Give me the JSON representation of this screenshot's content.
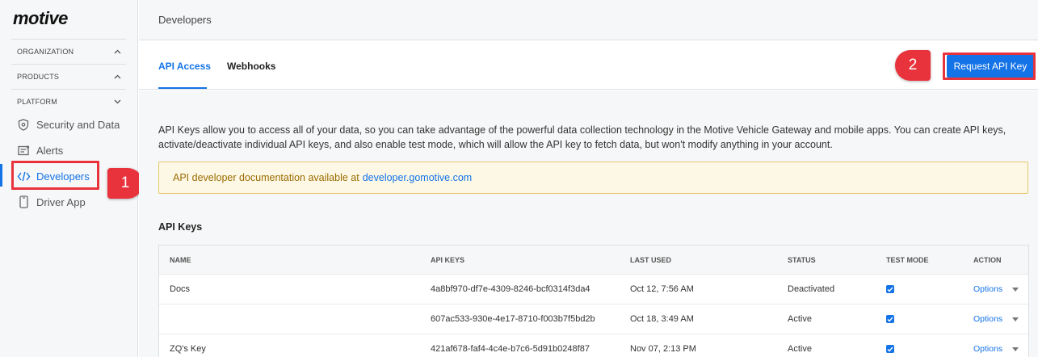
{
  "sidebar": {
    "logo": "motive",
    "sections": [
      {
        "label": "ORGANIZATION",
        "chevron": "up"
      },
      {
        "label": "PRODUCTS",
        "chevron": "up"
      },
      {
        "label": "PLATFORM",
        "chevron": "down"
      }
    ],
    "items": [
      {
        "label": "Security and Data",
        "icon": "shield-icon"
      },
      {
        "label": "Alerts",
        "icon": "alert-list-icon"
      },
      {
        "label": "Developers",
        "icon": "code-icon",
        "active": true
      },
      {
        "label": "Driver App",
        "icon": "phone-icon"
      }
    ]
  },
  "header": {
    "title": "Developers"
  },
  "tabs": [
    {
      "label": "API Access",
      "active": true
    },
    {
      "label": "Webhooks",
      "active": false
    }
  ],
  "request_button": "Request API Key",
  "callouts": [
    "1",
    "2"
  ],
  "description": "API Keys allow you to access all of your data, so you can take advantage of the powerful data collection technology in the Motive Vehicle Gateway and mobile apps. You can create API keys, activate/deactivate individual API keys, and also enable test mode, which will allow the API key to fetch data, but won't modify anything in your account.",
  "notice": {
    "text": "API developer documentation available at",
    "link": "developer.gomotive.com"
  },
  "keys_heading": "API Keys",
  "table": {
    "columns": [
      "NAME",
      "API KEYS",
      "LAST USED",
      "STATUS",
      "TEST MODE",
      "ACTION"
    ],
    "rows": [
      {
        "name": "Docs",
        "key": "4a8bf970-df7e-4309-8246-bcf0314f3da4",
        "last_used": "Oct 12, 7:56 AM",
        "status": "Deactivated",
        "test_mode": true,
        "action": "Options"
      },
      {
        "name": "",
        "key": "607ac533-930e-4e17-8710-f003b7f5bd2b",
        "last_used": "Oct 18, 3:49 AM",
        "status": "Active",
        "test_mode": true,
        "action": "Options"
      },
      {
        "name": "ZQ's Key",
        "key": "421af678-faf4-4c4e-b7c6-5d91b0248f87",
        "last_used": "Nov 07, 2:13 PM",
        "status": "Active",
        "test_mode": true,
        "action": "Options"
      }
    ]
  },
  "colors": {
    "accent": "#1473e6",
    "highlight": "#e8333c",
    "notice_bg": "#fdf8e6"
  }
}
